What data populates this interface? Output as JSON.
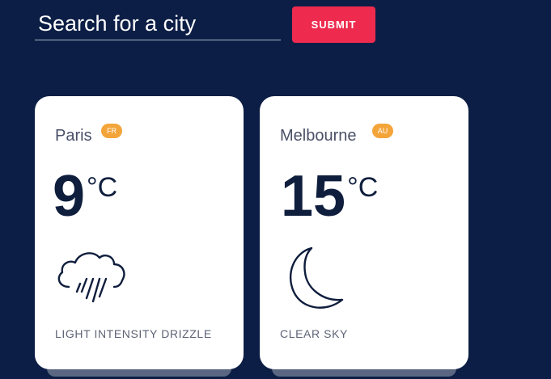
{
  "search": {
    "placeholder": "Search for a city",
    "submit_label": "SUBMIT"
  },
  "colors": {
    "background": "#0c1e45",
    "submit_button": "#ee2b4f",
    "badge": "#f4a53a",
    "card": "#ffffff",
    "temperature_text": "#0f1e3d"
  },
  "cards": [
    {
      "city": "Paris",
      "country": "FR",
      "temperature": "9",
      "unit": "°C",
      "description": "LIGHT INTENSITY DRIZZLE",
      "icon": "rain-cloud-icon"
    },
    {
      "city": "Melbourne",
      "country": "AU",
      "temperature": "15",
      "unit": "°C",
      "description": "CLEAR SKY",
      "icon": "crescent-moon-icon"
    }
  ]
}
